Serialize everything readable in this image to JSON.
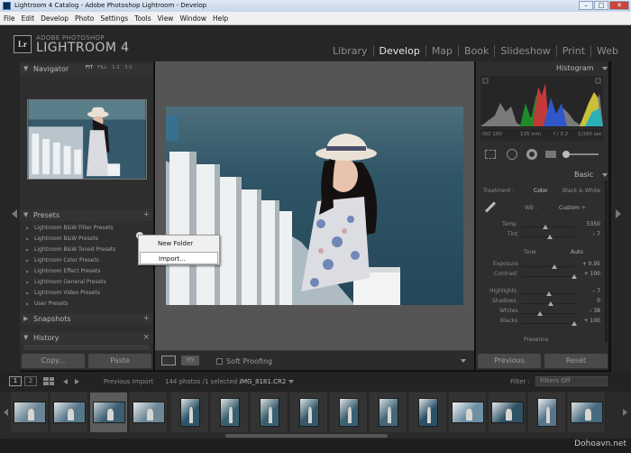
{
  "window": {
    "title": "Lightroom 4 Catalog - Adobe Photoshop Lightroom - Develop",
    "controls": [
      "–",
      "□",
      "✕"
    ]
  },
  "menu": [
    "File",
    "Edit",
    "Develop",
    "Photo",
    "Settings",
    "Tools",
    "View",
    "Window",
    "Help"
  ],
  "brand": {
    "logo": "Lr",
    "line1": "ADOBE PHOTOSHOP",
    "line2": "LIGHTROOM 4"
  },
  "modules": [
    {
      "label": "Library",
      "active": false
    },
    {
      "label": "Develop",
      "active": true
    },
    {
      "label": "Map",
      "active": false
    },
    {
      "label": "Book",
      "active": false
    },
    {
      "label": "Slideshow",
      "active": false
    },
    {
      "label": "Print",
      "active": false
    },
    {
      "label": "Web",
      "active": false
    }
  ],
  "left": {
    "navigator": {
      "title": "Navigator",
      "options": [
        "FIT",
        "FILL",
        "1:1",
        "3:1"
      ],
      "active_option": "FIT"
    },
    "presets": {
      "title": "Presets",
      "add_icon": "+",
      "items": [
        "Lightroom B&W Filter Presets",
        "Lightroom B&W Presets",
        "Lightroom B&W Toned Presets",
        "Lightroom Color Presets",
        "Lightroom Effect Presets",
        "Lightroom General Presets",
        "Lightroom Video Presets",
        "User Presets"
      ]
    },
    "snapshots": {
      "title": "Snapshots",
      "add_icon": "+"
    },
    "history": {
      "title": "History",
      "clear_icon": "×"
    },
    "copy_label": "Copy...",
    "paste_label": "Paste"
  },
  "context_menu": {
    "items": [
      "New Folder",
      "Import..."
    ],
    "hovered": "Import..."
  },
  "center": {
    "soft_proofing_label": "Soft Proofing"
  },
  "right": {
    "histogram": {
      "title": "Histogram",
      "iso": "ISO 100",
      "focal": "135 mm",
      "aperture": "f / 3.2",
      "shutter": "1/160 sec"
    },
    "basic": {
      "title": "Basic",
      "treatment_label": "Treatment :",
      "treatment_color": "Color",
      "treatment_bw": "Black & White",
      "wb_label": "WB :",
      "wb_value": "Custom ÷",
      "temp_label": "Temp",
      "temp_value": "5350",
      "tint_label": "Tint",
      "tint_value": "– 7",
      "tone_label": "Tone",
      "auto_label": "Auto",
      "exposure_label": "Exposure",
      "exposure_value": "+ 0.95",
      "contrast_label": "Contrast",
      "contrast_value": "+ 100",
      "highlights_label": "Highlights",
      "highlights_value": "– 7",
      "shadows_label": "Shadows",
      "shadows_value": "0",
      "whites_label": "Whites",
      "whites_value": "– 38",
      "blacks_label": "Blacks",
      "blacks_value": "+ 100",
      "presence_label": "Presence"
    },
    "previous_label": "Previous",
    "reset_label": "Reset"
  },
  "filmbar": {
    "page1": "1",
    "page2": "2",
    "source": "Previous Import",
    "count": "144 photos /1 selected /",
    "filename": "IMG_8181.CR2",
    "filter_label": "Filter :",
    "filter_value": "Filters Off"
  },
  "watermark": "Dohoavn.net",
  "colors": {
    "panel": "#2e2e2e",
    "active_module": "#e6e6e6",
    "sea": "#2f5566",
    "hat": "#e9e2d4"
  }
}
